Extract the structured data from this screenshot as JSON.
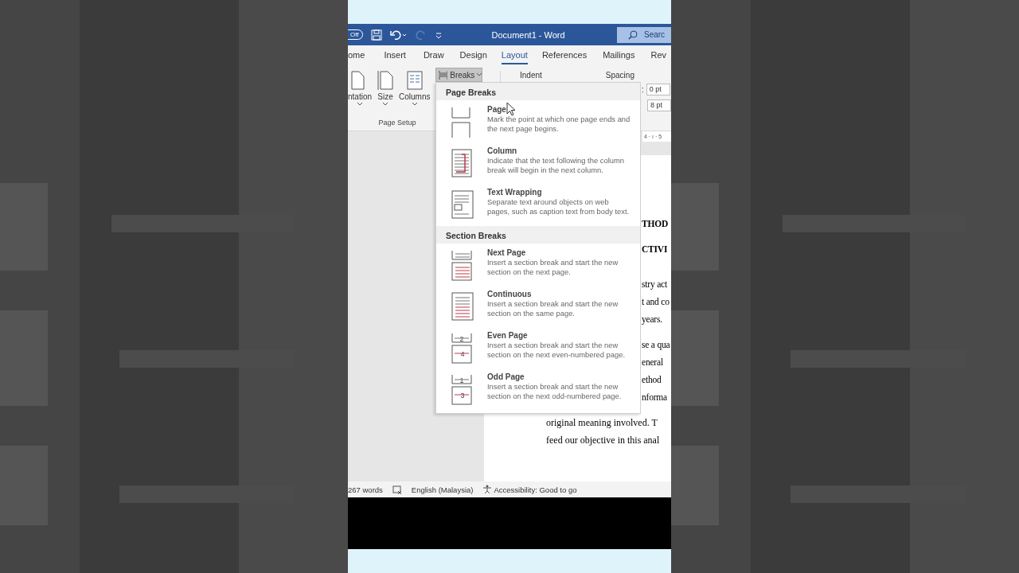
{
  "title_bar": {
    "autosave": "Off",
    "title": "Document1 - Word",
    "search": "Searc"
  },
  "tabs": [
    {
      "label": "ome",
      "selected": false
    },
    {
      "label": "Insert",
      "selected": false
    },
    {
      "label": "Draw",
      "selected": false
    },
    {
      "label": "Design",
      "selected": false
    },
    {
      "label": "Layout",
      "selected": true
    },
    {
      "label": "References",
      "selected": false
    },
    {
      "label": "Mailings",
      "selected": false
    },
    {
      "label": "Rev",
      "selected": false
    }
  ],
  "ribbon": {
    "page_setup": [
      {
        "kind": "orientation",
        "label": "ntation"
      },
      {
        "kind": "size",
        "label": "Size"
      },
      {
        "kind": "columns",
        "label": "Columns"
      }
    ],
    "group_label": "Page Setup",
    "breaks": "Breaks",
    "indent": "Indent",
    "spacing": "Spacing",
    "colon": ":",
    "before": "0 pt",
    "after": "8 pt",
    "ruler": "4 · ı · 5"
  },
  "menu": {
    "sections": [
      {
        "title": "Page Breaks",
        "items": [
          {
            "kind": "page",
            "title": "Page",
            "description": "Mark the point at which one page ends and the next page begins."
          },
          {
            "kind": "column",
            "title": "Column",
            "description": "Indicate that the text following the column break will begin in the next column."
          },
          {
            "kind": "text_wrapping",
            "title": "Text Wrapping",
            "description": "Separate text around objects on web pages, such as caption text from body text."
          }
        ]
      },
      {
        "title": "Section Breaks",
        "items": [
          {
            "kind": "next_page",
            "title": "Next Page",
            "description": "Insert a section break and start the new section on the next page."
          },
          {
            "kind": "continuous",
            "title": "Continuous",
            "description": "Insert a section break and start the new section on the same page."
          },
          {
            "kind": "even_page",
            "title": "Even Page",
            "description": "Insert a section break and start the new section on the next even-numbered page.",
            "icon_digits": [
              "2",
              "4"
            ]
          },
          {
            "kind": "odd_page",
            "title": "Odd Page",
            "description": "Insert a section break and start the new section on the next odd-numbered page.",
            "icon_digits": [
              "1",
              "3"
            ]
          }
        ]
      }
    ]
  },
  "document": {
    "beside_menu": [
      {
        "kind": "heading",
        "lines": [
          "THOD"
        ]
      },
      {
        "kind": "heading",
        "lines": [
          "CTIVI"
        ]
      },
      {
        "kind": "body",
        "lines": [
          "stry act",
          "t and co",
          "years."
        ]
      },
      {
        "kind": "body",
        "lines": [
          "se a qua",
          "eneral",
          "ethod",
          "nforma"
        ]
      }
    ],
    "below_menu": [
      "original meaning involved. T",
      "feed our objective in this anal"
    ]
  },
  "status_bar": {
    "words": "267 words",
    "language": "English (Malaysia)",
    "accessibility": "Accessibility: Good to go"
  }
}
